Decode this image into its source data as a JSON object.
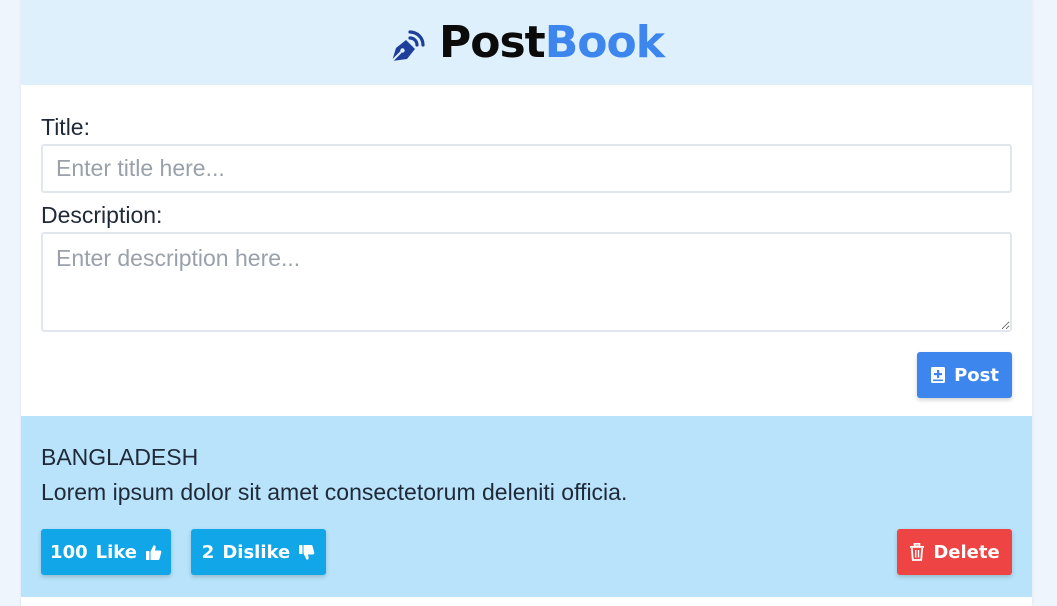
{
  "brand": {
    "name_part1": "Post",
    "name_part2": "Book",
    "icon": "fountain-pen-icon",
    "colors": {
      "part1": "#0b0b0b",
      "part2": "#3d86ee",
      "header_bg": "#dff0fd"
    }
  },
  "form": {
    "title_label": "Title:",
    "title_placeholder": "Enter title here...",
    "title_value": "",
    "description_label": "Description:",
    "description_placeholder": "Enter description here...",
    "description_value": "",
    "post_button": {
      "label": "Post",
      "icon": "add-document-icon",
      "color": "#3d86ee"
    }
  },
  "posts": [
    {
      "title": "BANGLADESH",
      "description": "Lorem ipsum dolor sit amet consectetorum deleniti officia.",
      "likes": "100",
      "like_label": "Like",
      "like_icon": "thumbs-up-icon",
      "dislikes": "2",
      "dislike_label": "Dislike",
      "dislike_icon": "thumbs-down-icon",
      "delete_label": "Delete",
      "delete_icon": "trash-icon",
      "colors": {
        "card_bg": "#b8e3fa",
        "like": "#11a6e8",
        "delete": "#ee4444"
      }
    }
  ]
}
